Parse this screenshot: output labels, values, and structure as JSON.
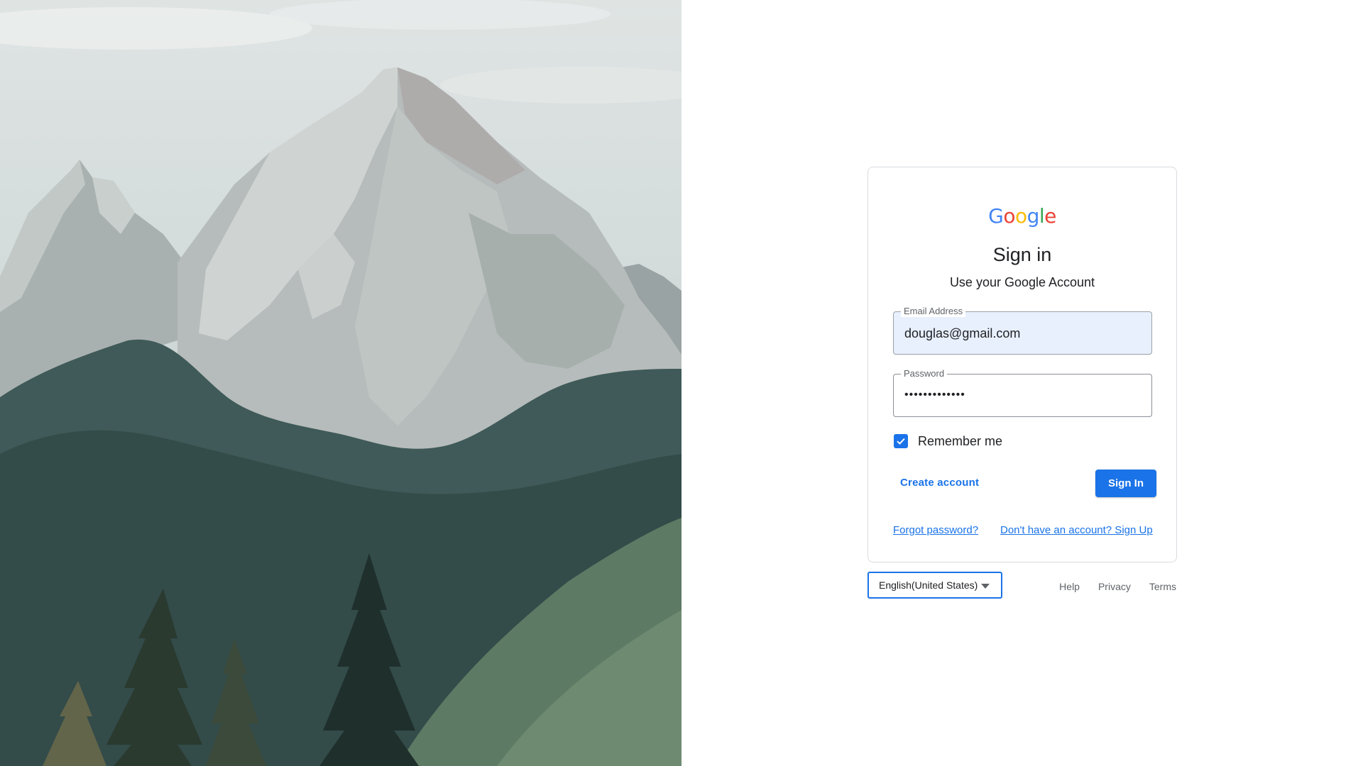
{
  "brand": {
    "logo_letters": [
      "G",
      "o",
      "o",
      "g",
      "l",
      "e"
    ],
    "logo_colors": [
      "#4285F4",
      "#EA4335",
      "#FBBC05",
      "#4285F4",
      "#34A853",
      "#EA4335"
    ]
  },
  "card": {
    "title": "Sign in",
    "subtitle": "Use your Google Account",
    "email": {
      "label": "Email Address",
      "value": "douglas@gmail.com"
    },
    "password": {
      "label": "Password",
      "value": "•••••••••••••"
    },
    "remember": {
      "label": "Remember me",
      "checked": true
    },
    "create_account_label": "Create account",
    "sign_in_label": "Sign In",
    "forgot_password_label": "Forgot password?",
    "signup_label": "Don't have an account? Sign Up"
  },
  "footer": {
    "language": "English(United States)",
    "links": [
      "Help",
      "Privacy",
      "Terms"
    ]
  },
  "colors": {
    "accent": "#1a73e8",
    "email_field_bg": "#e8f0fe",
    "card_border": "#dadce0"
  },
  "icons": {
    "checkbox": "checkmark-icon",
    "language_dropdown": "caret-down-icon"
  }
}
